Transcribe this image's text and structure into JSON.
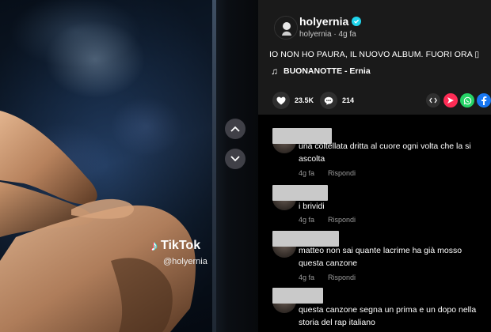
{
  "video": {
    "watermark_logo": "TikTok",
    "watermark_handle": "@holyernia"
  },
  "nav": {
    "up_icon": "chevron-up-icon",
    "down_icon": "chevron-down-icon"
  },
  "post": {
    "username": "holyernia",
    "sub_line": "holyernia · 4g fa",
    "caption": "IO NON HO PAURA, IL NUOVO ALBUM. FUORI ORA ▯",
    "music": "BUONANOTTE - Ernia",
    "likes": "23.5K",
    "comments_count": "214"
  },
  "share_icons": [
    "embed-icon",
    "send-icon",
    "whatsapp-icon",
    "facebook-icon"
  ],
  "colors": {
    "verified": "#20d5ec",
    "send": "#fe2c55",
    "whatsapp": "#25d366",
    "facebook": "#1877f2"
  },
  "comments": [
    {
      "text": "una coltellata dritta al cuore ogni volta che la si ascolta",
      "time": "4g fa",
      "reply": "Rispondi"
    },
    {
      "text": "i brividi",
      "time": "4g fa",
      "reply": "Rispondi"
    },
    {
      "text": "matteo non sai quante lacrime ha già mosso questa canzone",
      "time": "4g fa",
      "reply": "Rispondi"
    },
    {
      "text": "questa canzone segna un prima e un dopo nella storia del rap italiano",
      "time": "",
      "reply": ""
    }
  ]
}
